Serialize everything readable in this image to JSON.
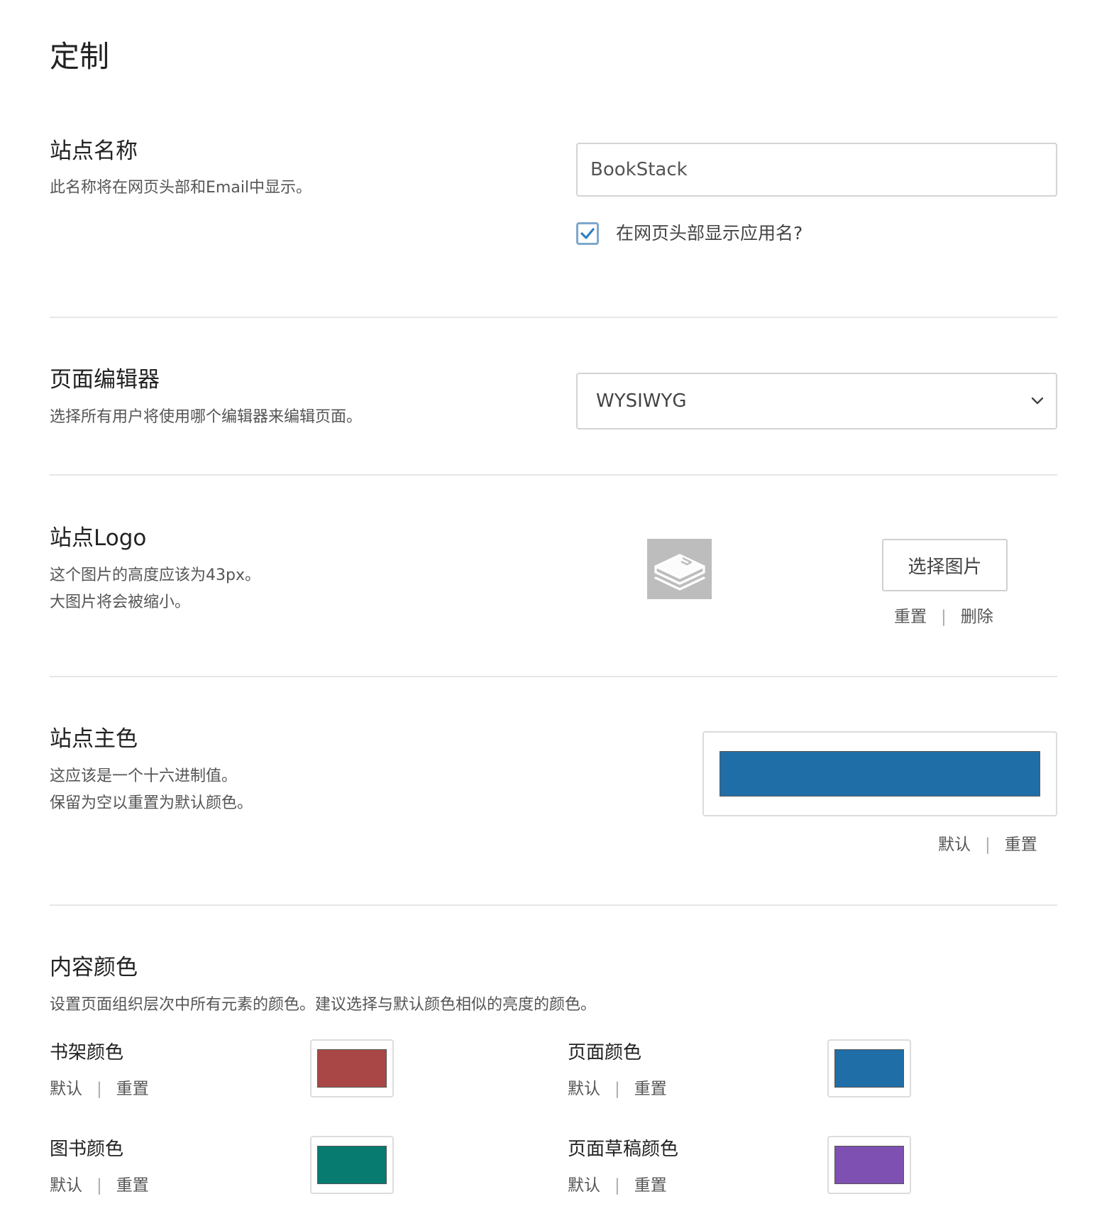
{
  "page": {
    "title": "定制"
  },
  "site_name": {
    "title": "站点名称",
    "description": "此名称将在网页头部和Email中显示。",
    "value": "BookStack",
    "show_name_label": "在网页头部显示应用名?",
    "show_name_checked": true
  },
  "editor": {
    "title": "页面编辑器",
    "description": "选择所有用户将使用哪个编辑器来编辑页面。",
    "selected": "WYSIWYG"
  },
  "logo": {
    "title": "站点Logo",
    "description_1": "这个图片的高度应该为43px。",
    "description_2": "大图片将会被缩小。",
    "choose_label": "选择图片",
    "reset_label": "重置",
    "delete_label": "删除",
    "icon": "book-stack-icon"
  },
  "primary_color": {
    "title": "站点主色",
    "description_1": "这应该是一个十六进制值。",
    "description_2": "保留为空以重置为默认颜色。",
    "color": "#206ea7",
    "default_label": "默认",
    "reset_label": "重置"
  },
  "content_colors": {
    "title": "内容颜色",
    "description": "设置页面组织层次中所有元素的颜色。建议选择与默认颜色相似的亮度的颜色。",
    "items": [
      {
        "label": "书架颜色",
        "color": "#a94747",
        "default_label": "默认",
        "reset_label": "重置"
      },
      {
        "label": "页面颜色",
        "color": "#206ea7",
        "default_label": "默认",
        "reset_label": "重置"
      },
      {
        "label": "图书颜色",
        "color": "#077b70",
        "default_label": "默认",
        "reset_label": "重置"
      },
      {
        "label": "页面草稿颜色",
        "color": "#7e50b1",
        "default_label": "默认",
        "reset_label": "重置"
      }
    ]
  }
}
